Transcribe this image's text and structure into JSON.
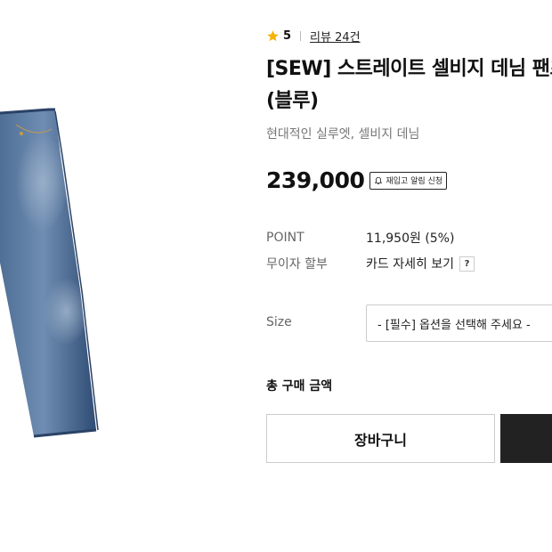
{
  "rating": {
    "value": "5",
    "review_link": "리뷰 24건"
  },
  "product": {
    "title": "[SEW] 스트레이트 셀비지 데님 팬츠 (블루)",
    "subtitle": "현대적인 실루엣, 셀비지 데님",
    "price": "239,000",
    "restock_label": "재입고 알림 신청"
  },
  "info": [
    {
      "label": "POINT",
      "value": "11,950원 (5%)"
    },
    {
      "label": "무이자 할부",
      "value": "카드 자세히 보기",
      "help": "?"
    }
  ],
  "option": {
    "label": "Size",
    "placeholder": "- [필수] 옵션을 선택해 주세요 -"
  },
  "total": {
    "label": "총 구매 금액"
  },
  "buttons": {
    "cart": "장바구니",
    "buy": ""
  },
  "icons": {
    "star": "star-icon",
    "bell": "bell-icon",
    "help": "help-icon"
  },
  "colors": {
    "star": "#F5B300",
    "denim": "#3E5F88",
    "buy_button": "#222222"
  }
}
